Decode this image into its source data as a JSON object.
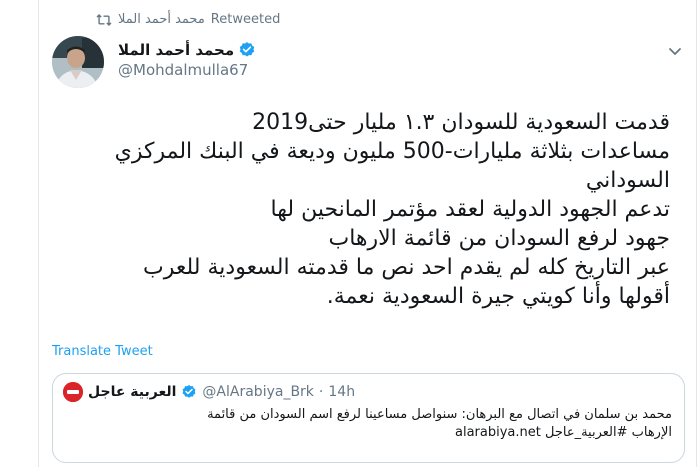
{
  "retweet": {
    "name": "محمد أحمد الملا",
    "label": "Retweeted"
  },
  "author": {
    "display_name": "محمد أحمد الملا",
    "handle": "@Mohdalmulla67",
    "verified": true
  },
  "tweet": {
    "lines": [
      "قدمت السعودية للسودان ١.٣ مليار حتى2019",
      "مساعدات بثلاثة مليارات-500 مليون وديعة في البنك المركزي",
      "السوداني",
      "تدعم الجهود الدولية لعقد مؤتمر المانحين لها",
      "جهود لرفع السودان من قائمة الارهاب",
      "عبر التاريخ كله لم يقدم احد نص ما قدمته السعودية للعرب",
      "أقولها وأنا كويتي جيرة السعودية نعمة."
    ]
  },
  "translate_label": "Translate Tweet",
  "quoted": {
    "display_name": "العربية عاجل",
    "handle": "@AlArabiya_Brk",
    "separator": "·",
    "time": "14h",
    "verified": true,
    "lines": [
      "محمد بن سلمان في اتصال مع البرهان: سنواصل مساعينا لرفع اسم السودان من قائمة",
      "الإرهاب #العربية_عاجل alarabiya.net"
    ]
  },
  "colors": {
    "link": "#1da1f2",
    "muted": "#657786",
    "border": "#ccd6dd",
    "verified": "#1da1f2",
    "brand_red": "#d9252a"
  },
  "icons": {
    "retweet": "retweet-icon",
    "verified": "verified-badge-icon",
    "menu": "chevron-down-icon"
  }
}
